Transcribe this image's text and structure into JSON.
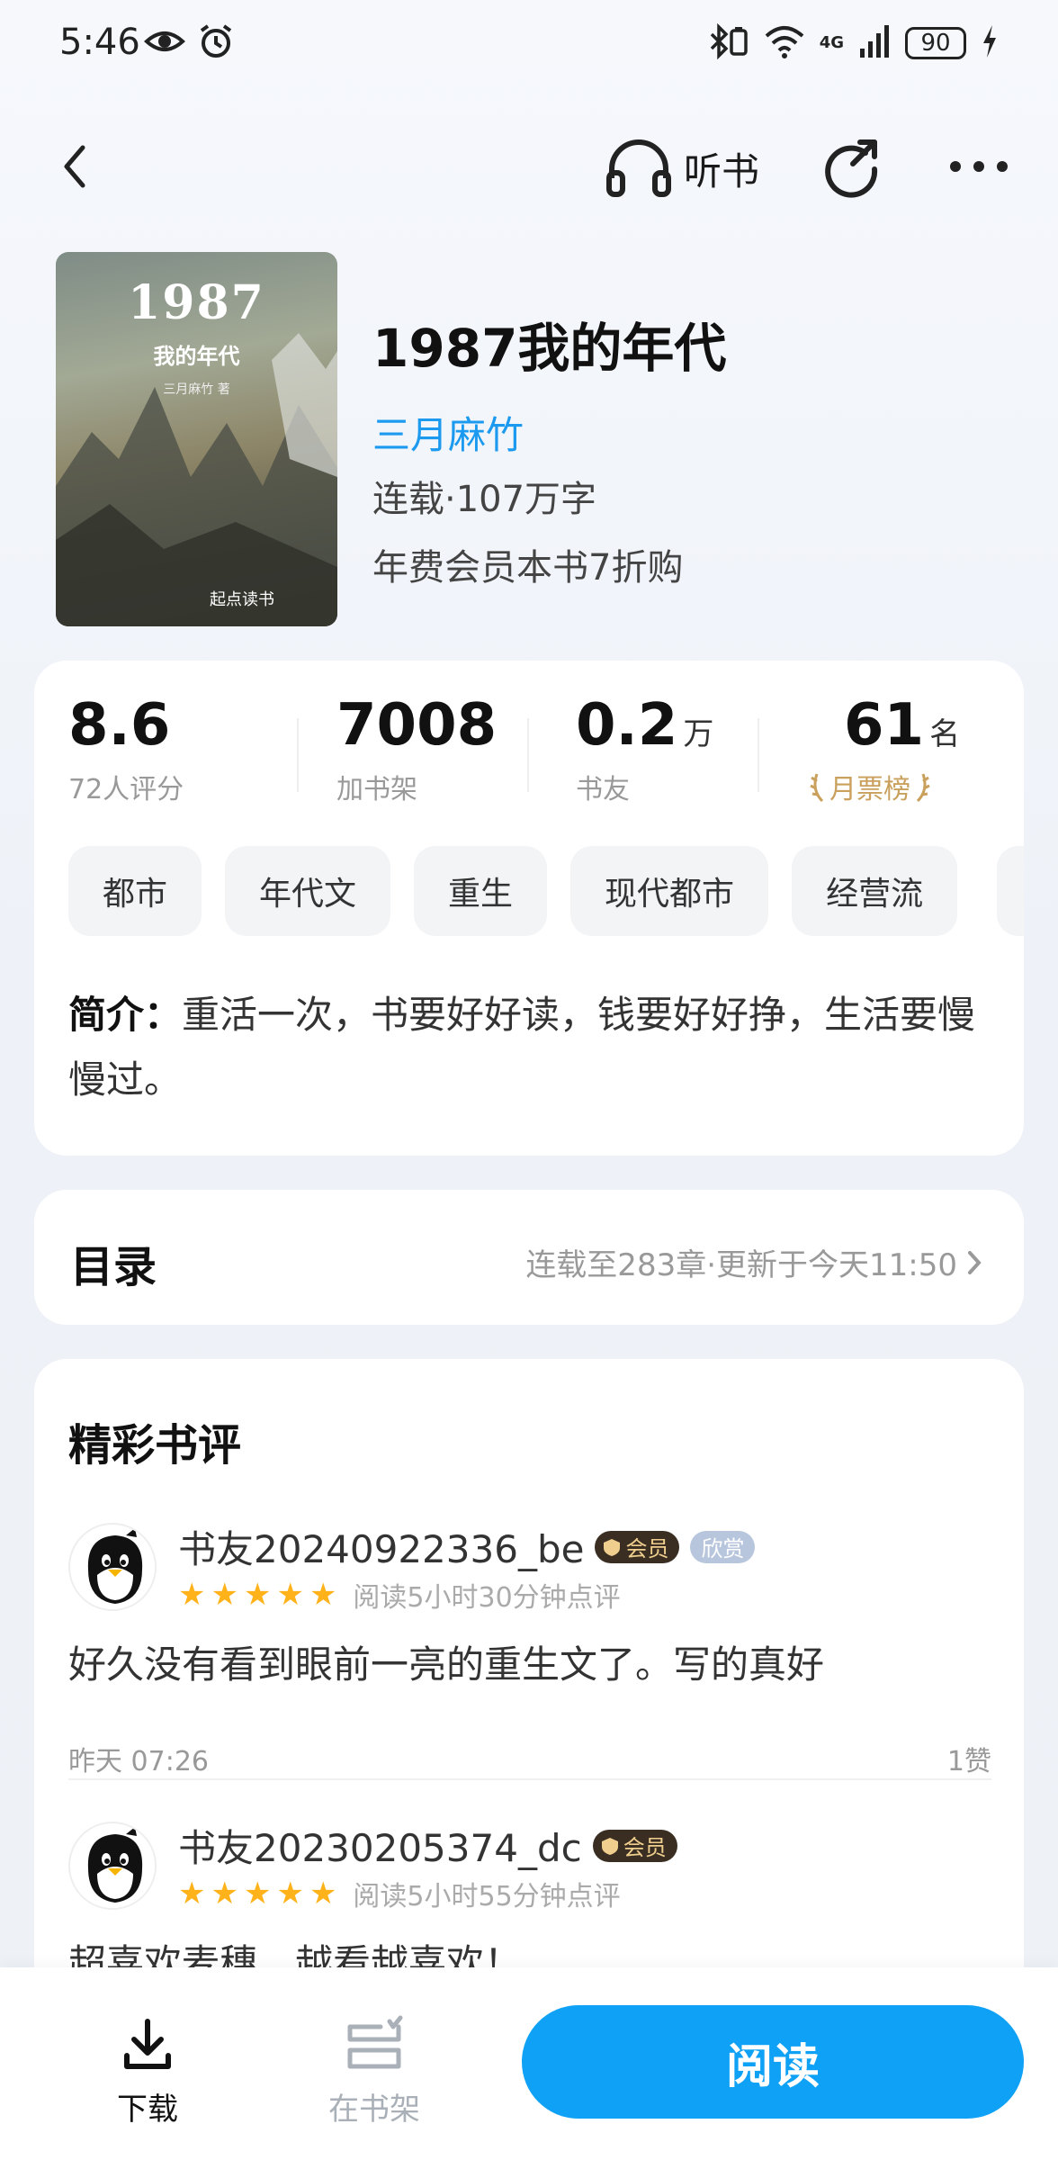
{
  "status_bar": {
    "time": "5:46",
    "battery": "90",
    "network": "4G"
  },
  "header": {
    "listen_label": "听书"
  },
  "book": {
    "cover": {
      "title": "1987",
      "subtitle": "我的年代",
      "author": "三月麻竹 著",
      "publisher": "起点读书"
    },
    "title": "1987我的年代",
    "author": "三月麻竹",
    "status": "连载·107万字",
    "vip_offer": "年费会员本书7折购"
  },
  "stats": [
    {
      "value": "8.6",
      "unit": "",
      "label": "72人评分"
    },
    {
      "value": "7008",
      "unit": "",
      "label": "加书架"
    },
    {
      "value": "0.2",
      "unit": "万",
      "label": "书友"
    },
    {
      "value": "61",
      "unit": "名",
      "label": "月票榜"
    }
  ],
  "tags": [
    "都市",
    "年代文",
    "重生",
    "现代都市",
    "经营流"
  ],
  "intro": {
    "label": "简介：",
    "text": "重活一次，书要好好读，钱要好好挣，生活要慢慢过。"
  },
  "toc": {
    "title": "目录",
    "info": "连载至283章·更新于今天11:50"
  },
  "reviews": {
    "title": "精彩书评",
    "items": [
      {
        "username": "书友20240922336_be",
        "vip_badge": "会员",
        "extra_badge": "欣赏",
        "stars": 5,
        "read_time": "阅读5小时30分钟点评",
        "text": "好久没有看到眼前一亮的重生文了。写的真好",
        "date": "昨天 07:26",
        "likes": "1赞"
      },
      {
        "username": "书友20230205374_dc",
        "vip_badge": "会员",
        "stars": 5,
        "read_time": "阅读5小时55分钟点评",
        "text": "超喜欢麦穗，越看越喜欢！"
      }
    ]
  },
  "bottom_bar": {
    "download_label": "下载",
    "shelf_label": "在书架",
    "read_label": "阅读"
  },
  "colors": {
    "accent": "#0fa1f6",
    "author_link": "#1c9aef",
    "star": "#ffb21a",
    "rank_gold": "#c9a05c"
  }
}
